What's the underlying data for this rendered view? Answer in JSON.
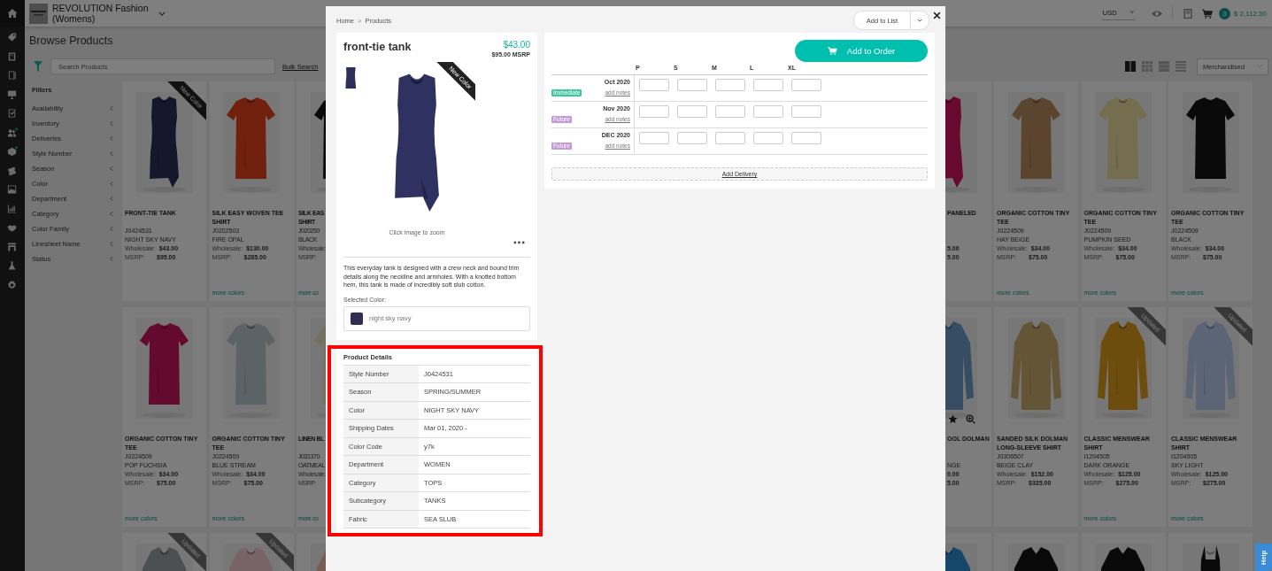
{
  "header": {
    "brand": "REVOLUTION Fashion (Womens)",
    "currency": "USD",
    "cart_count": "3",
    "cart_total": "$ 2,112.50"
  },
  "page": {
    "title": "Browse Products",
    "search": {
      "placeholder": "Search Products"
    },
    "bulk_search": "Bulk Search",
    "sort": "Merchandised",
    "views": [
      {
        "kind": "large-grid",
        "selected": true
      },
      {
        "kind": "small-grid",
        "selected": false
      },
      {
        "kind": "list",
        "selected": false
      },
      {
        "kind": "compact-list",
        "selected": false
      }
    ]
  },
  "filters": {
    "title": "Filters",
    "items": [
      "Availability",
      "Inventory",
      "Deliveries",
      "Style Number",
      "Season",
      "Color",
      "Department",
      "Category",
      "Color Family",
      "Linesheet Name",
      "Status"
    ]
  },
  "grid": {
    "rows": [
      {
        "left": [
          {
            "kind": "full",
            "name": "FRONT-TIE TANK",
            "style": "J0424531",
            "color_name": "NIGHT SKY NAVY",
            "wholesale_label": "Wholesale:",
            "wholesale": "$43.00",
            "msrp_label": "MSRP:",
            "msrp": "$95.00",
            "ribbon": {
              "text": "New Color",
              "kind": "new"
            }
          },
          {
            "kind": "full",
            "name": "SILK EASY WOVEN TEE SHIRT",
            "style": "J0202503",
            "color_name": "FIRE OPAL",
            "wholesale_label": "Wholesale:",
            "wholesale": "$130.00",
            "msrp_label": "MSRP:",
            "msrp": "$285.00",
            "link": "more colors"
          },
          {
            "kind": "partial-left",
            "name": "SILK EAS\nSHIRT",
            "style": "J020250",
            "color_name": "BLACK",
            "wholesale_label": "Wholesale:",
            "msrp_label": "MSRP:",
            "link": "more co"
          }
        ],
        "right": [
          {
            "kind": "partial-right",
            "name": "PANELED",
            "wholesale": "5.00",
            "msrp": "5.00"
          },
          {
            "kind": "full",
            "name": "ORGANIC COTTON TINY TEE",
            "style": "J0224509",
            "color_name": "HAY BEIGE",
            "wholesale_label": "Wholesale:",
            "wholesale": "$34.00",
            "msrp_label": "MSRP:",
            "msrp": "$75.00",
            "link": "more colors"
          },
          {
            "kind": "full",
            "name": "ORGANIC COTTON TINY TEE",
            "style": "J0224509",
            "color_name": "PUMPKIN SEED",
            "wholesale_label": "Wholesale:",
            "wholesale": "$34.00",
            "msrp_label": "MSRP:",
            "msrp": "$75.00",
            "link": "more colors"
          },
          {
            "kind": "full",
            "name": "ORGANIC COTTON TINY TEE",
            "style": "J0224509",
            "color_name": "BLACK",
            "wholesale_label": "Wholesale:",
            "wholesale": "$34.00",
            "msrp_label": "MSRP:",
            "msrp": "$75.00",
            "link": "more colors"
          }
        ]
      },
      {
        "left": [
          {
            "kind": "full",
            "name": "ORGANIC COTTON TINY TEE",
            "style": "J0224509",
            "color_name": "POP FUCHSIA",
            "wholesale_label": "Wholesale:",
            "wholesale": "$34.00",
            "msrp_label": "MSRP:",
            "msrp": "$75.00",
            "link": "more colors"
          },
          {
            "kind": "full",
            "name": "ORGANIC COTTON TINY TEE",
            "style": "J0224509",
            "color_name": "BLUE STREAM",
            "wholesale_label": "Wholesale:",
            "wholesale": "$34.00",
            "msrp_label": "MSRP:",
            "msrp": "$75.00",
            "link": "more colors"
          },
          {
            "kind": "partial-left",
            "name": "LINEN BL",
            "style": "J031370",
            "color_name": "OATMEAL",
            "wholesale_label": "Wholesale:",
            "msrp_label": "MSRP:",
            "link": "more co"
          }
        ],
        "right": [
          {
            "kind": "partial-right",
            "name": "OOL DOLMAN",
            "color_name": "NGE",
            "wholesale": "0.00",
            "msrp": "5.00",
            "hover_actions": true
          },
          {
            "kind": "full",
            "name": "SANDED SILK DOLMAN LONG-SLEEVE SHIRT",
            "style": "J0306507",
            "color_name": "BEIGE CLAY",
            "wholesale_label": "Wholesale:",
            "wholesale": "$152.00",
            "msrp_label": "MSRP:",
            "msrp": "$335.00"
          },
          {
            "kind": "full",
            "name": "CLASSIC MENSWEAR SHIRT",
            "style": "I1204505",
            "color_name": "DARK ORANGE",
            "wholesale_label": "Wholesale:",
            "wholesale": "$125.00",
            "msrp_label": "MSRP:",
            "msrp": "$275.00",
            "link": "more colors",
            "ribbon": {
              "text": "Updated",
              "kind": "updated"
            }
          },
          {
            "kind": "full",
            "name": "CLASSIC MENSWEAR SHIRT",
            "style": "I1204505",
            "color_name": "SKY LIGHT",
            "wholesale_label": "Wholesale:",
            "wholesale": "$125.00",
            "msrp_label": "MSRP:",
            "msrp": "$275.00",
            "link": "more colors",
            "ribbon": {
              "text": "Updated",
              "kind": "updated"
            }
          }
        ]
      },
      {
        "left": [
          {
            "kind": "image-only",
            "ribbon": {
              "text": "Updated",
              "kind": "updated"
            }
          },
          {
            "kind": "image-only",
            "ribbon": {
              "text": "Updated",
              "kind": "updated"
            }
          },
          {
            "kind": "partial-left"
          }
        ],
        "right": [
          {
            "kind": "partial-right"
          },
          {
            "kind": "image-only"
          },
          {
            "kind": "image-only"
          },
          {
            "kind": "image-only"
          }
        ]
      }
    ]
  },
  "modal": {
    "breadcrumb": {
      "items": [
        "Home",
        "Products"
      ],
      "separator": ">"
    },
    "add_to_list": "Add to List",
    "product": {
      "title": "front-tie tank",
      "price": "$43.00",
      "msrp": "$95.00 MSRP",
      "ribbon": "New Color",
      "zoom_hint": "Click image to zoom",
      "description": "This everyday tank is designed with a crew neck and bound trim details along the neckline and armholes. With a knotted bottom hem, this tank is made of incredibly soft slub cotton.",
      "selected_color_label": "Selected Color:",
      "selected_color": {
        "name": "night sky navy",
        "color": "#2f2d52"
      }
    },
    "details": {
      "title": "Product Details",
      "highlighted": true,
      "rows": [
        {
          "label": "Style Number",
          "value": "J0424531"
        },
        {
          "label": "Season",
          "value": "SPRING/SUMMER"
        },
        {
          "label": "Color",
          "value": "NIGHT SKY NAVY"
        },
        {
          "label": "Shipping Dates",
          "value": "Mar 01, 2020 -"
        },
        {
          "label": "Color Code",
          "value": "y7k"
        },
        {
          "label": "Department",
          "value": "WOMEN"
        },
        {
          "label": "Category",
          "value": "TOPS"
        },
        {
          "label": "Subcategory",
          "value": "TANKS"
        },
        {
          "label": "Fabric",
          "value": "SEA SLUB"
        }
      ]
    },
    "order": {
      "button": "Add to Order",
      "sizes": [
        "P",
        "S",
        "M",
        "L",
        "XL"
      ],
      "deliveries": [
        {
          "date": "Oct 2020",
          "tag": "Immediate",
          "color": "#3cc79e",
          "notes": "add notes"
        },
        {
          "date": "Nov 2020",
          "tag": "Future",
          "color": "#c39ad6",
          "notes": "add notes"
        },
        {
          "date": "DEC 2020",
          "tag": "Future",
          "color": "#c39ad6",
          "notes": "add notes"
        }
      ],
      "add_delivery": "Add Delivery"
    }
  },
  "help": "Help"
}
